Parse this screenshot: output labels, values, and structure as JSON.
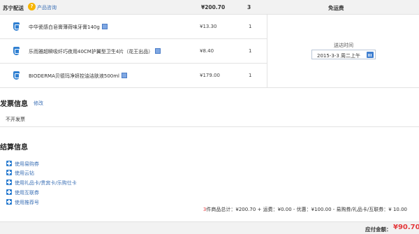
{
  "shipment": {
    "seller": "苏宁配送",
    "consult_icon": "question-face-icon",
    "consult_link": "产品咨询",
    "total": "¥200.70",
    "quantity": "3",
    "shipping_fee": "免运费"
  },
  "items": [
    {
      "name": "中华瓷感白皂膏薄荷味牙膏140g",
      "price": "¥13.30",
      "qty": "1",
      "icon": "shield-icon"
    },
    {
      "name": "乐而雅超瞬吸纤巧夜用40CM护翼型卫生4片（花王出品）",
      "price": "¥8.40",
      "qty": "1",
      "icon": "shield-icon"
    },
    {
      "name": "BIODERMA贝德玛净妍控油洁肤液500ml",
      "price": "¥179.00",
      "qty": "1",
      "icon": "shield-icon"
    }
  ],
  "delivery": {
    "label": "送达时间",
    "date": "2015-3-3 周二上午",
    "calendar_icon": "calendar-icon"
  },
  "invoice": {
    "title": "发票信息",
    "edit": "修改",
    "value": "不开发票"
  },
  "settlement": {
    "title": "结算信息",
    "options": [
      "使用易购券",
      "使用云钻",
      "使用礼品卡/贵宾卡/乐购仕卡",
      "使用互联券",
      "使用推荐号"
    ]
  },
  "summary": {
    "count": "3",
    "text": "件商品总计：¥200.70 + 运费：¥0.00 - 优惠：¥100.00 - 易购券/礼品卡/互联券：¥ 10.00"
  },
  "payment": {
    "label": "应付金额：",
    "amount": "¥90.70"
  },
  "colors": {
    "accent_red": "#e4393c",
    "link_blue": "#3a6fb5",
    "icon_blue": "#2f7fd1"
  }
}
